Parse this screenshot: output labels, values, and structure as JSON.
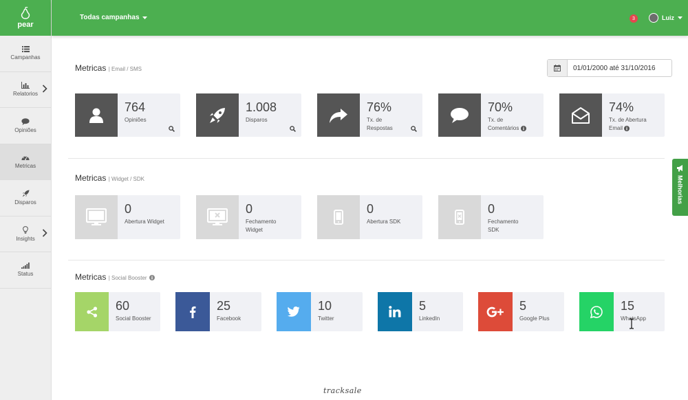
{
  "brand": {
    "name": "pear"
  },
  "sidebar": {
    "items": [
      {
        "label": "Campanhas",
        "icon": "list-icon"
      },
      {
        "label": "Relatorios",
        "icon": "bar-chart-icon"
      },
      {
        "label": "Opiniões",
        "icon": "comment-icon"
      },
      {
        "label": "Metricas",
        "icon": "dashboard-icon"
      },
      {
        "label": "Disparos",
        "icon": "rocket-icon"
      },
      {
        "label": "Insights",
        "icon": "lightbulb-icon"
      },
      {
        "label": "Status",
        "icon": "signal-icon"
      }
    ]
  },
  "header": {
    "campaign_selector": "Todas campanhas",
    "notifications": "3",
    "user_name": "Luiz"
  },
  "date_range": {
    "value": "01/01/2000 até 31/10/2016"
  },
  "sections": {
    "email": {
      "title": "Metricas",
      "subtitle": "| Email / SMS"
    },
    "widget": {
      "title": "Metricas",
      "subtitle": "| Widget / SDK"
    },
    "social": {
      "title": "Metricas",
      "subtitle": "| Social Booster"
    }
  },
  "email_cards": [
    {
      "value": "764",
      "label": "Opiniões",
      "icon": "user-icon"
    },
    {
      "value": "1.008",
      "label": "Disparos",
      "icon": "rocket-icon"
    },
    {
      "value": "76%",
      "label_l1": "Tx. de",
      "label_l2": "Respostas",
      "icon": "share-arrow-icon"
    },
    {
      "value": "70%",
      "label_l1": "Tx. de",
      "label_l2": "Comentários",
      "icon": "speech-bubble-icon"
    },
    {
      "value": "74%",
      "label_l1": "Tx. de Abertura",
      "label_l2": "Email",
      "icon": "open-envelope-icon"
    }
  ],
  "widget_cards": [
    {
      "value": "0",
      "label": "Abertura Widget",
      "icon": "monitor-icon"
    },
    {
      "value": "0",
      "label_l1": "Fechamento",
      "label_l2": "Widget",
      "icon": "monitor-close-icon"
    },
    {
      "value": "0",
      "label": "Abertura SDK",
      "icon": "mobile-icon"
    },
    {
      "value": "0",
      "label_l1": "Fechamento",
      "label_l2": "SDK",
      "icon": "mobile-close-icon"
    }
  ],
  "social_cards": [
    {
      "value": "60",
      "label": "Social Booster",
      "icon": "share-icon",
      "color": "#a5d568"
    },
    {
      "value": "25",
      "label": "Facebook",
      "icon": "facebook-icon",
      "color": "#3b5998"
    },
    {
      "value": "10",
      "label": "Twitter",
      "icon": "twitter-icon",
      "color": "#55acee"
    },
    {
      "value": "5",
      "label": "LinkedIn",
      "icon": "linkedin-icon",
      "color": "#0e76a8"
    },
    {
      "value": "5",
      "label": "Google Plus",
      "icon": "google-plus-icon",
      "color": "#dd4b39"
    },
    {
      "value": "15",
      "label": "WhatsApp",
      "icon": "whatsapp-icon",
      "color": "#25d366"
    }
  ],
  "feedback_tab": {
    "label": "Melhorias"
  },
  "footer": {
    "logo": "tracksale"
  },
  "colors": {
    "primary": "#4caf50",
    "dark_icon": "#555555",
    "disabled_icon": "#d9d9d9",
    "card_bg": "#f0f1f5"
  }
}
